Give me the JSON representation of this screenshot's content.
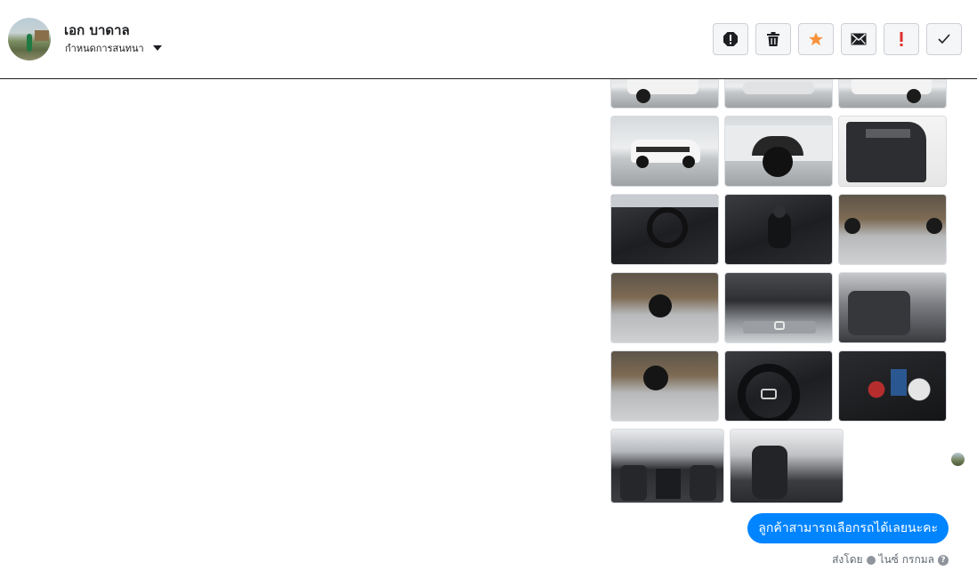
{
  "contact": {
    "name": "เอก บาดาล",
    "assign_label": "กำหนดการสนทนา"
  },
  "toolbar": {
    "buttons": [
      {
        "name": "report-spam",
        "icon": "alert-octagon-icon"
      },
      {
        "name": "delete",
        "icon": "trash-icon"
      },
      {
        "name": "star",
        "icon": "star-icon",
        "color": "#f7923b"
      },
      {
        "name": "mark-unread",
        "icon": "envelope-icon"
      },
      {
        "name": "follow-up",
        "icon": "exclamation-icon",
        "color": "#e02d2d"
      },
      {
        "name": "mark-done",
        "icon": "checkmark-icon"
      }
    ]
  },
  "thread": {
    "photos": [
      "white pickup front (cropped)",
      "pickup front (cropped)",
      "pickup front (cropped)",
      "white pickup side",
      "rear wheel arch",
      "door interior",
      "steering wheel interior",
      "gear shifter",
      "underbody rear",
      "underbody front",
      "engine bay",
      "rear seats",
      "underbody view",
      "steering wheel close-up",
      "instrument cluster",
      "front cabin from rear",
      "driver seat"
    ],
    "message": {
      "text": "ลูกค้าสามารถเลือกรถได้เลยนะคะ",
      "sent_by_label": "ส่งโดย",
      "sender": "ไนซ์ กรกมล"
    }
  },
  "colors": {
    "accent": "#0084ff",
    "star": "#f7923b",
    "flag": "#e02d2d"
  }
}
